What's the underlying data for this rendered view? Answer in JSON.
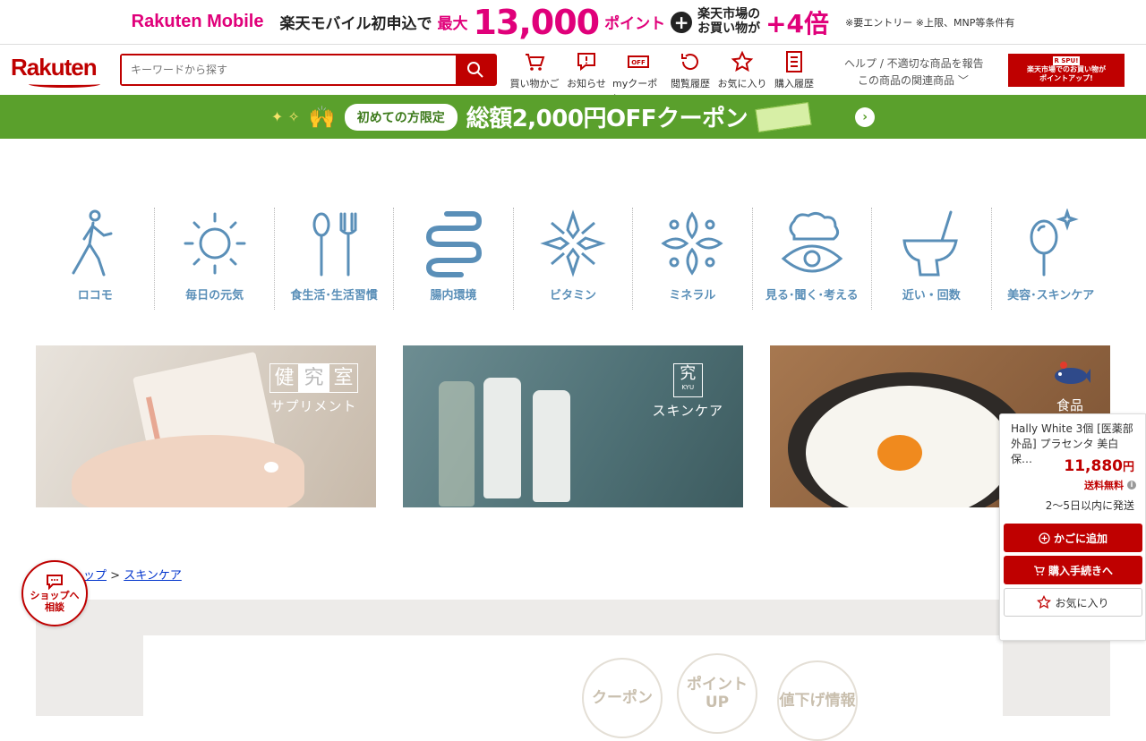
{
  "promo": {
    "logo": "Rakuten Mobile",
    "lead": "楽天モバイル初申込で",
    "max_label": "最大",
    "points": "13,000",
    "points_unit": "ポイント",
    "plus": "+",
    "market_line1": "楽天市場の",
    "market_line2": "お買い物が",
    "multiplier": "+4倍",
    "note": "※要エントリー ※上限、MNP等条件有"
  },
  "header": {
    "logo": "Rakuten",
    "search_placeholder": "キーワードから探す",
    "nav": [
      {
        "label": "買い物かご",
        "icon": "cart-icon"
      },
      {
        "label": "お知らせ",
        "icon": "notice-icon"
      },
      {
        "label": "myクーポン",
        "icon": "coupon-icon"
      },
      {
        "label": "閲覧履歴",
        "icon": "history-icon"
      },
      {
        "label": "お気に入り",
        "icon": "star-icon"
      },
      {
        "label": "購入履歴",
        "icon": "receipt-icon"
      }
    ],
    "help_link": "ヘルプ / 不適切な商品を報告",
    "related_link": "この商品の関連商品",
    "spu_title": "R SPU!",
    "spu_line1": "楽天市場でのお買い物が",
    "spu_line2": "ポイントアップ!"
  },
  "green_banner": {
    "pill": "初めての方限定",
    "main": "総額2,000円OFFクーポン"
  },
  "categories": [
    {
      "label": "ロコモ",
      "icon": "walking-person-icon"
    },
    {
      "label": "毎日の元気",
      "icon": "sun-icon"
    },
    {
      "label": "食生活･生活習慣",
      "icon": "spoon-fork-icon"
    },
    {
      "label": "腸内環境",
      "icon": "intestine-icon"
    },
    {
      "label": "ビタミン",
      "icon": "vitamin-icon"
    },
    {
      "label": "ミネラル",
      "icon": "mineral-icon"
    },
    {
      "label": "見る･聞く･考える",
      "icon": "brain-eye-icon"
    },
    {
      "label": "近い・回数",
      "icon": "toilet-icon"
    },
    {
      "label": "美容･スキンケア",
      "icon": "mirror-icon"
    }
  ],
  "banners": [
    {
      "tag_chars": [
        "健",
        "究",
        "室"
      ],
      "sub": "サプリメント"
    },
    {
      "tag_char": "究",
      "tag_small": "KYU",
      "sub": "スキンケア"
    },
    {
      "sub": "食品"
    }
  ],
  "breadcrumb": {
    "top": "トップ",
    "separator": ">",
    "current": "スキンケア"
  },
  "feature_circles": [
    "クーポン",
    "ポイントUP",
    "値下げ情報"
  ],
  "chat": {
    "label_line1": "ショップへ",
    "label_line2": "相談"
  },
  "float_card": {
    "name": "Hally White 3個 [医薬部外品] プラセンタ 美白 保…",
    "price": "11,880",
    "currency": "円",
    "shipping": "送料無料",
    "delivery": "2～5日以内に発送",
    "add_to_cart": "かごに追加",
    "checkout": "購入手続きへ",
    "favorite": "お気に入り"
  },
  "colors": {
    "brand_red": "#bf0000",
    "promo_pink": "#e0007a",
    "banner_green": "#5aa02c",
    "category_blue": "#5a8fb8"
  }
}
